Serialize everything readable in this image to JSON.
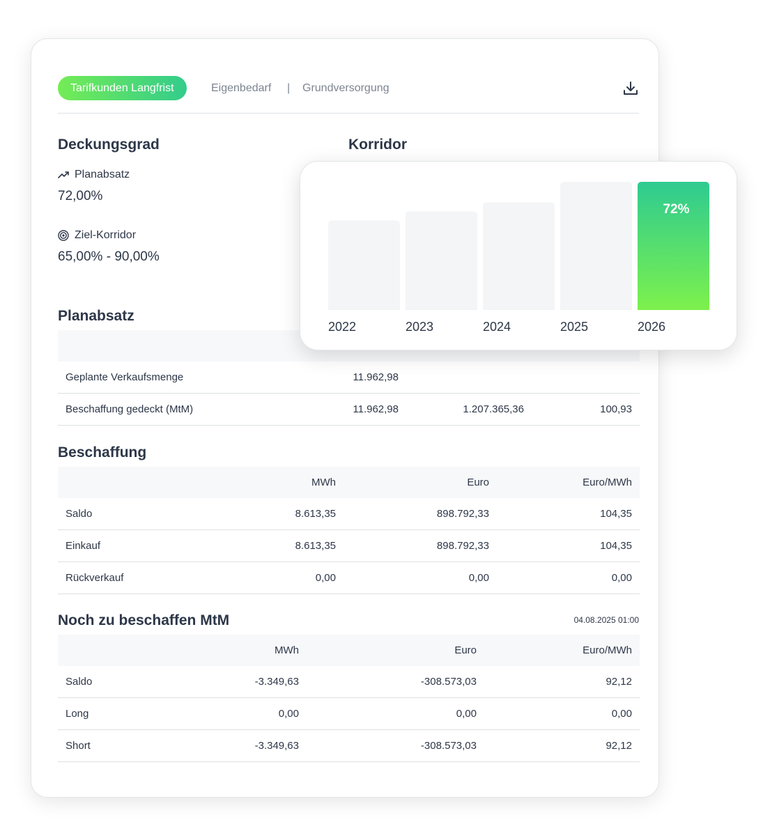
{
  "tabs": {
    "active": "Tarifkunden Langfrist",
    "items": [
      "Eigenbedarf",
      "Grundversorgung"
    ],
    "separator": "|"
  },
  "deckungsgrad": {
    "title": "Deckungsgrad",
    "planabsatz_label": "Planabsatz",
    "planabsatz_value": "72,00%",
    "ziel_label": "Ziel-Korridor",
    "ziel_value": "65,00% - 90,00%"
  },
  "korridor": {
    "title": "Korridor"
  },
  "planabsatz": {
    "title": "Planabsatz",
    "rows": [
      [
        "Geplante Verkaufsmenge",
        "11.962,98",
        "",
        ""
      ],
      [
        "Beschaffung gedeckt (MtM)",
        "11.962,98",
        "1.207.365,36",
        "100,93"
      ]
    ]
  },
  "beschaffung": {
    "title": "Beschaffung",
    "headers": [
      "",
      "MWh",
      "Euro",
      "Euro/MWh"
    ],
    "rows": [
      [
        "Saldo",
        "8.613,35",
        "898.792,33",
        "104,35"
      ],
      [
        "Einkauf",
        "8.613,35",
        "898.792,33",
        "104,35"
      ],
      [
        "Rückverkauf",
        "0,00",
        "0,00",
        "0,00"
      ]
    ]
  },
  "noch": {
    "title": "Noch zu beschaffen MtM",
    "timestamp": "04.08.2025 01:00",
    "headers": [
      "",
      "MWh",
      "Euro",
      "Euro/MWh"
    ],
    "rows": [
      [
        "Saldo",
        "-3.349,63",
        "-308.573,03",
        "92,12"
      ],
      [
        "Long",
        "0,00",
        "0,00",
        "0,00"
      ],
      [
        "Short",
        "-3.349,63",
        "-308.573,03",
        "92,12"
      ]
    ]
  },
  "colors": {
    "accent_start": "#74ec55",
    "accent_end": "#33cc8c",
    "bar_inactive": "#f4f5f7",
    "text": "#2d3748",
    "muted": "#7c8591"
  },
  "chart_data": {
    "type": "bar",
    "categories": [
      "2022",
      "2023",
      "2024",
      "2025",
      "2026"
    ],
    "values": [
      null,
      null,
      null,
      null,
      72
    ],
    "relative_heights": [
      0.7,
      0.77,
      0.84,
      1.0,
      1.0
    ],
    "highlight_index": 4,
    "data_labels": [
      "",
      "",
      "",
      "",
      "72%"
    ],
    "grid": false
  }
}
